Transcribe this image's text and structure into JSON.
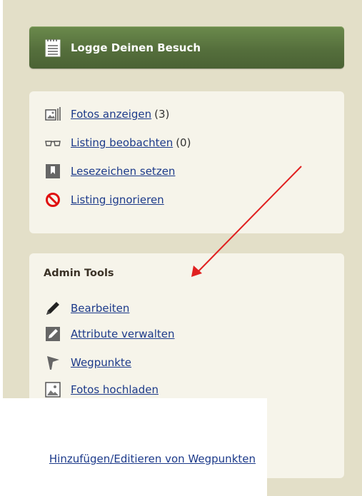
{
  "log_visit": {
    "label": "Logge Deinen Besuch",
    "icon": "notepad-icon"
  },
  "actions": [
    {
      "label": "Fotos anzeigen",
      "count": "(3)",
      "icon": "photos-icon"
    },
    {
      "label": "Listing beobachten",
      "count": "(0)",
      "icon": "glasses-icon"
    },
    {
      "label": "Lesezeichen setzen",
      "count": "",
      "icon": "bookmark-icon"
    },
    {
      "label": "Listing ignorieren",
      "count": "",
      "icon": "forbidden-icon"
    }
  ],
  "admin": {
    "title": "Admin Tools",
    "items": [
      {
        "label": "Bearbeiten",
        "icon": "pencil-icon"
      },
      {
        "label": "Attribute verwalten",
        "icon": "pencil-box-icon"
      },
      {
        "label": "Wegpunkte",
        "icon": "flag-icon"
      },
      {
        "label": "Fotos hochladen",
        "icon": "photo-upload-icon"
      }
    ]
  },
  "tooltip": {
    "link": "Hinzufügen/Editieren von Wegpunkten"
  },
  "colors": {
    "button_green": "#556f3c",
    "highlight": "#ffff00",
    "arrow": "#e02020",
    "link": "#1c3a8a"
  }
}
